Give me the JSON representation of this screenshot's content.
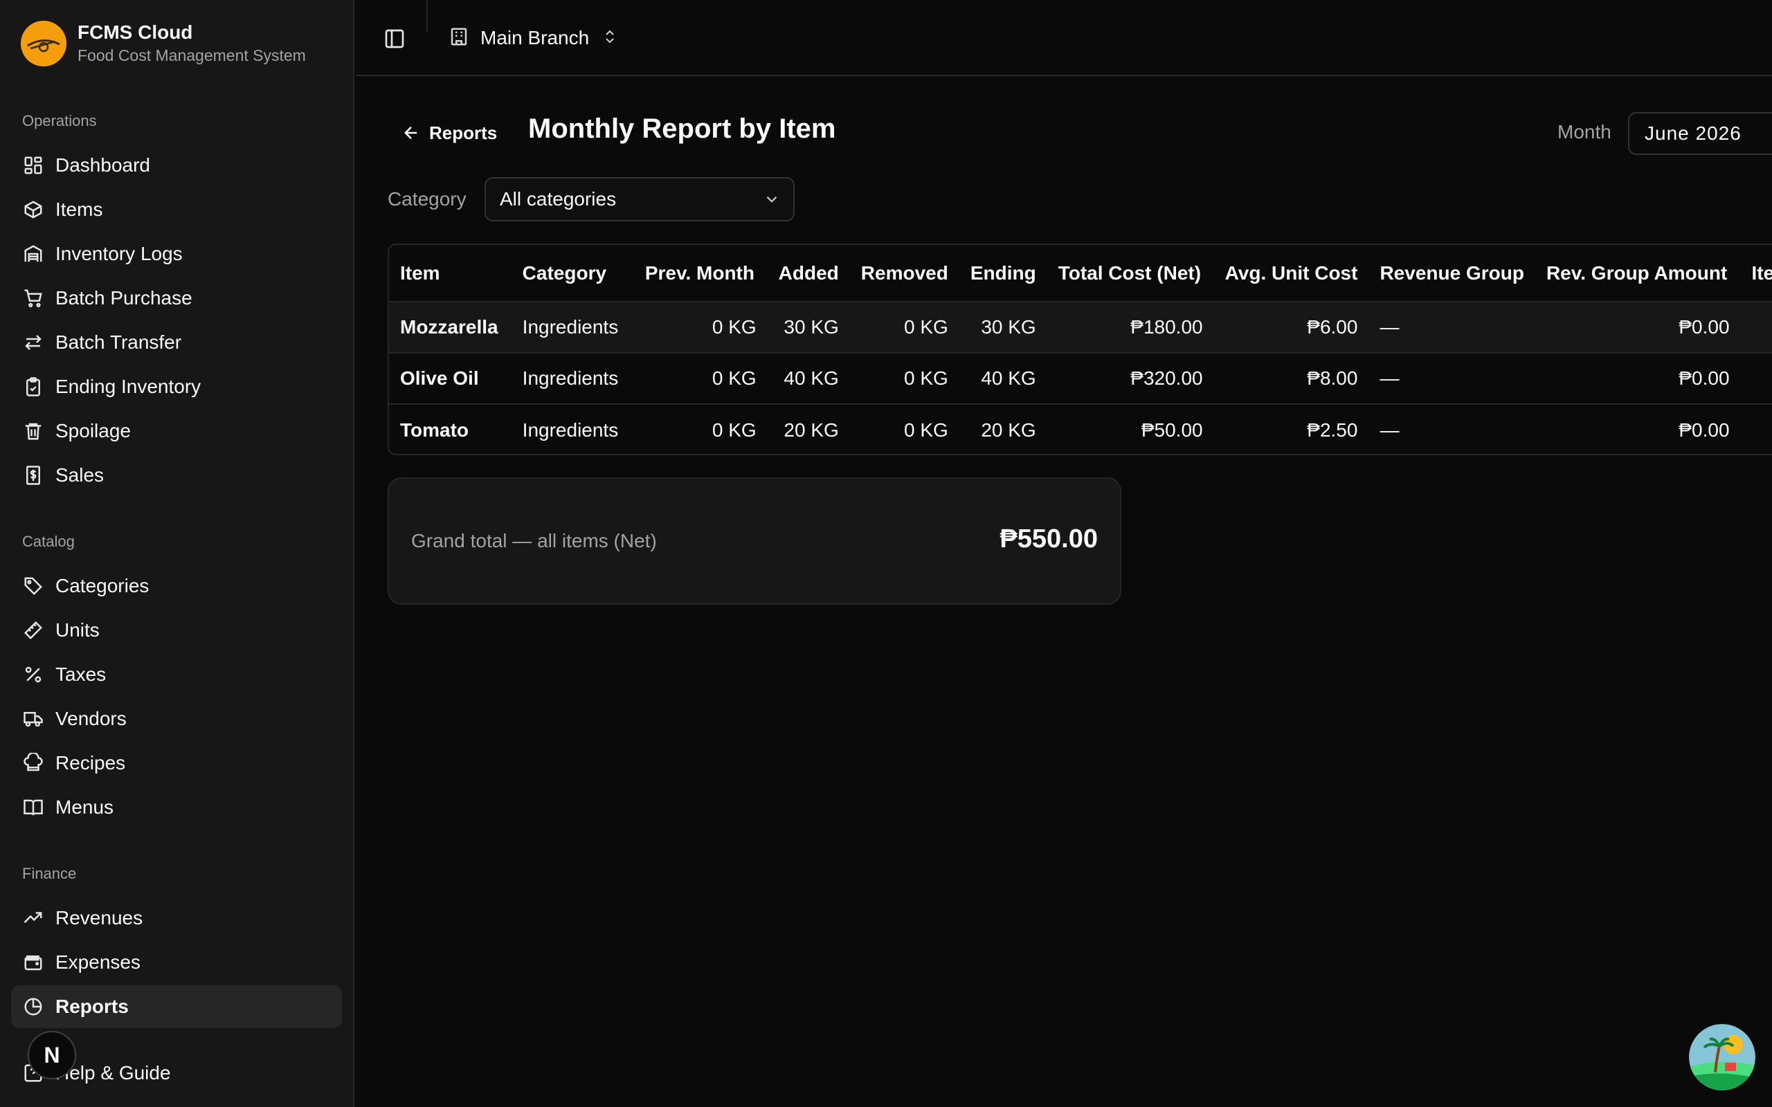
{
  "brand": {
    "name": "FCMS Cloud",
    "subtitle": "Food Cost Management System"
  },
  "sidebar": {
    "groups": [
      {
        "label": "Operations"
      },
      {
        "label": "Catalog"
      },
      {
        "label": "Finance"
      }
    ],
    "items": [
      {
        "label": "Dashboard",
        "icon": "dashboard-icon"
      },
      {
        "label": "Items",
        "icon": "package-icon"
      },
      {
        "label": "Inventory Logs",
        "icon": "warehouse-icon"
      },
      {
        "label": "Batch Purchase",
        "icon": "cart-icon"
      },
      {
        "label": "Batch Transfer",
        "icon": "transfer-icon"
      },
      {
        "label": "Ending Inventory",
        "icon": "clipboard-check-icon"
      },
      {
        "label": "Spoilage",
        "icon": "trash-icon"
      },
      {
        "label": "Sales",
        "icon": "receipt-dollar-icon"
      },
      {
        "label": "Categories",
        "icon": "tag-icon"
      },
      {
        "label": "Units",
        "icon": "ruler-icon"
      },
      {
        "label": "Taxes",
        "icon": "percent-icon"
      },
      {
        "label": "Vendors",
        "icon": "truck-icon"
      },
      {
        "label": "Recipes",
        "icon": "chef-hat-icon"
      },
      {
        "label": "Menus",
        "icon": "book-open-icon"
      },
      {
        "label": "Revenues",
        "icon": "trending-up-icon"
      },
      {
        "label": "Expenses",
        "icon": "wallet-icon"
      },
      {
        "label": "Reports",
        "icon": "pie-chart-icon",
        "active": true
      },
      {
        "label": "Help & Guide",
        "icon": "help-icon"
      }
    ],
    "avatar_letter": "N"
  },
  "header": {
    "branch": "Main Branch"
  },
  "page": {
    "back_label": "Reports",
    "title": "Monthly Report by Item",
    "month_label": "Month",
    "month_value": "June 2026",
    "category_label": "Category",
    "category_value": "All categories"
  },
  "table": {
    "columns": [
      "Item",
      "Category",
      "Prev. Month",
      "Added",
      "Removed",
      "Ending",
      "Total Cost (Net)",
      "Avg. Unit Cost",
      "Revenue Group",
      "Rev. Group Amount",
      "Ite"
    ],
    "rows": [
      [
        "Mozzarella",
        "Ingredients",
        "0 KG",
        "30 KG",
        "0 KG",
        "30 KG",
        "₱180.00",
        "₱6.00",
        "—",
        "₱0.00",
        ""
      ],
      [
        "Olive Oil",
        "Ingredients",
        "0 KG",
        "40 KG",
        "0 KG",
        "40 KG",
        "₱320.00",
        "₱8.00",
        "—",
        "₱0.00",
        ""
      ],
      [
        "Tomato",
        "Ingredients",
        "0 KG",
        "20 KG",
        "0 KG",
        "20 KG",
        "₱50.00",
        "₱2.50",
        "—",
        "₱0.00",
        ""
      ]
    ]
  },
  "summary": {
    "label": "Grand total — all items (Net)",
    "value": "₱550.00"
  },
  "colors": {
    "background": "#0a0a0a",
    "sidebar": "#171717",
    "border": "#262626",
    "muted": "#a3a3a3",
    "logo": "#f59e0b"
  }
}
